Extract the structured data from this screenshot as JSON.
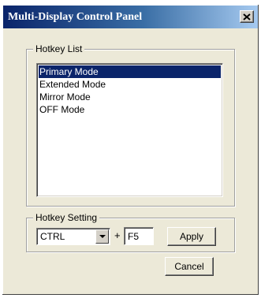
{
  "window": {
    "title": "Multi-Display Control Panel",
    "close_label": "X"
  },
  "hotkey_list": {
    "label": "Hotkey List",
    "items": [
      {
        "label": "Primary Mode",
        "selected": true
      },
      {
        "label": "Extended Mode",
        "selected": false
      },
      {
        "label": "Mirror Mode",
        "selected": false
      },
      {
        "label": "OFF Mode",
        "selected": false
      }
    ]
  },
  "hotkey_setting": {
    "label": "Hotkey Setting",
    "modifier_value": "CTRL",
    "plus_label": "+",
    "key_value": "F5",
    "apply_label": "Apply"
  },
  "footer": {
    "cancel_label": "Cancel"
  },
  "colors": {
    "title_gradient_start": "#0a246a",
    "title_gradient_end": "#a6caf0",
    "selection": "#0a246a",
    "dialog_background": "#ece9d8"
  }
}
